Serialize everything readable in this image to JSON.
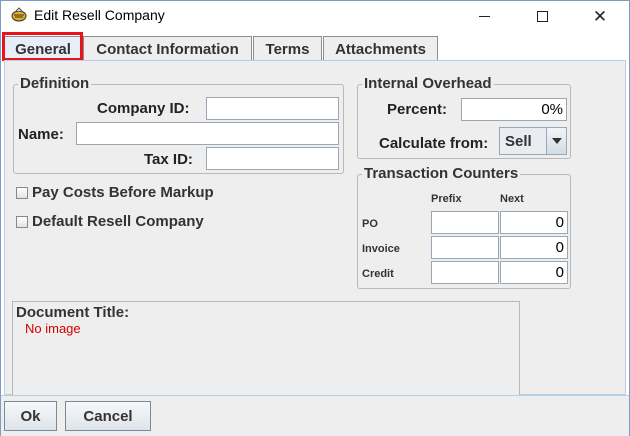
{
  "window": {
    "title": "Edit Resell Company",
    "minimize_icon": "minimize-icon",
    "maximize_icon": "maximize-icon",
    "close_icon": "close-icon"
  },
  "tabs": [
    {
      "label": "General",
      "active": true
    },
    {
      "label": "Contact Information",
      "active": false
    },
    {
      "label": "Terms",
      "active": false
    },
    {
      "label": "Attachments",
      "active": false
    }
  ],
  "definition": {
    "title": "Definition",
    "company_id_label": "Company ID:",
    "company_id_value": "",
    "name_label": "Name:",
    "name_value": "",
    "tax_id_label": "Tax ID:",
    "tax_id_value": ""
  },
  "checkboxes": {
    "pay_costs_label": "Pay Costs Before Markup",
    "pay_costs_checked": false,
    "default_resell_label": "Default Resell Company",
    "default_resell_checked": false
  },
  "internal_overhead": {
    "title": "Internal Overhead",
    "percent_label": "Percent:",
    "percent_value": "0%",
    "calculate_label": "Calculate from:",
    "calculate_value": "Sell"
  },
  "transaction_counters": {
    "title": "Transaction Counters",
    "prefix_header": "Prefix",
    "next_header": "Next",
    "rows": [
      {
        "label": "PO",
        "prefix": "",
        "next": "0"
      },
      {
        "label": "Invoice",
        "prefix": "",
        "next": "0"
      },
      {
        "label": "Credit",
        "prefix": "",
        "next": "0"
      }
    ]
  },
  "document": {
    "title": "Document Title:",
    "placeholder": "No image"
  },
  "buttons": {
    "ok": "Ok",
    "cancel": "Cancel"
  },
  "colors": {
    "highlight": "#e8141b",
    "no_image": "#d40000"
  }
}
